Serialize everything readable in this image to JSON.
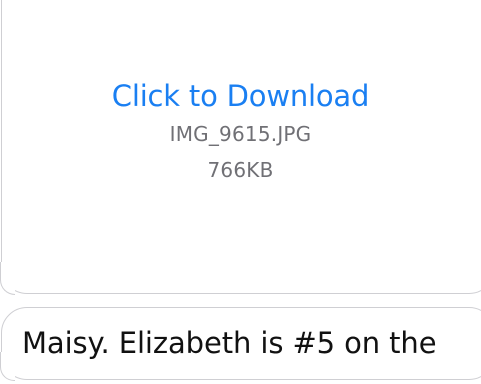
{
  "attachment": {
    "link_label": "Click to Download",
    "file_name": "IMG_9615.JPG",
    "file_size": "766KB"
  },
  "message": {
    "text": "Maisy. Elizabeth is #5 on the"
  },
  "colors": {
    "link": "#1a7ff2",
    "meta_text": "#707075",
    "bubble_border": "#cfcfd3",
    "message_text": "#111111"
  }
}
